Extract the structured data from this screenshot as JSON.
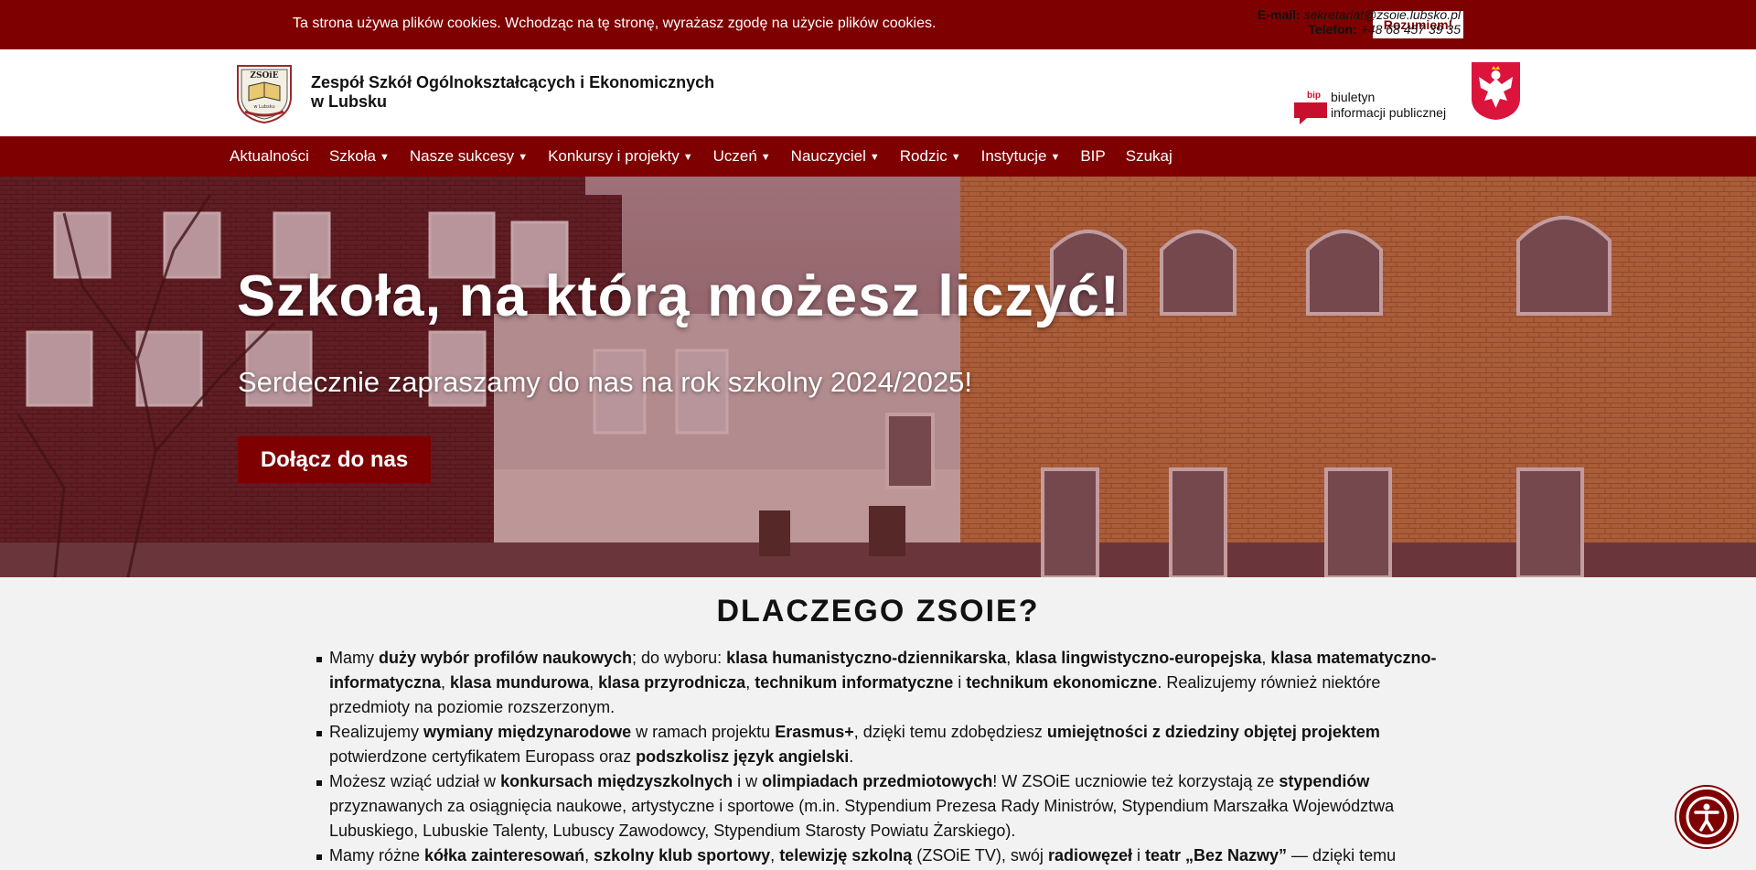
{
  "cookie": {
    "text": "Ta strona używa plików cookies. Wchodząc na tę stronę, wyrażasz zgodę na użycie plików cookies.",
    "button": "Rozumiem!"
  },
  "header": {
    "school_name_line1": "Zespół Szkół Ogólnokształcących i Ekonomicznych",
    "school_name_line2": "w Lubsku",
    "email_label": "E-mail:",
    "email_value": "sekretariat@zsoie.lubsko.pl",
    "phone_label": "Telefon:",
    "phone_value": "+48 68 457 39 35",
    "bip_line1": "biuletyn",
    "bip_line2": "informacji publicznej",
    "bip_tag": "bip"
  },
  "nav": {
    "items": [
      {
        "label": "Aktualności",
        "caret": false
      },
      {
        "label": "Szkoła",
        "caret": true
      },
      {
        "label": "Nasze sukcesy",
        "caret": true
      },
      {
        "label": "Konkursy i projekty",
        "caret": true
      },
      {
        "label": "Uczeń",
        "caret": true
      },
      {
        "label": "Nauczyciel",
        "caret": true
      },
      {
        "label": "Rodzic",
        "caret": true
      },
      {
        "label": "Instytucje",
        "caret": true
      },
      {
        "label": "BIP",
        "caret": false
      },
      {
        "label": "Szukaj",
        "caret": false
      }
    ],
    "caret_glyph": "▼"
  },
  "hero": {
    "title": "Szkoła, na którą możesz liczyć!",
    "subtitle": "Serdecznie zapraszamy do nas na rok szkolny 2024/2025!",
    "button": "Dołącz do nas"
  },
  "why": {
    "title": "DLACZEGO ZSOIE?"
  },
  "colors": {
    "brand": "#7f0000",
    "white": "#ffffff",
    "background": "#f2f2f2"
  },
  "icons": {
    "logo": "school-crest-logo",
    "bip": "bip-flag-icon",
    "eagle": "polish-eagle-emblem",
    "accessibility": "accessibility-icon"
  }
}
